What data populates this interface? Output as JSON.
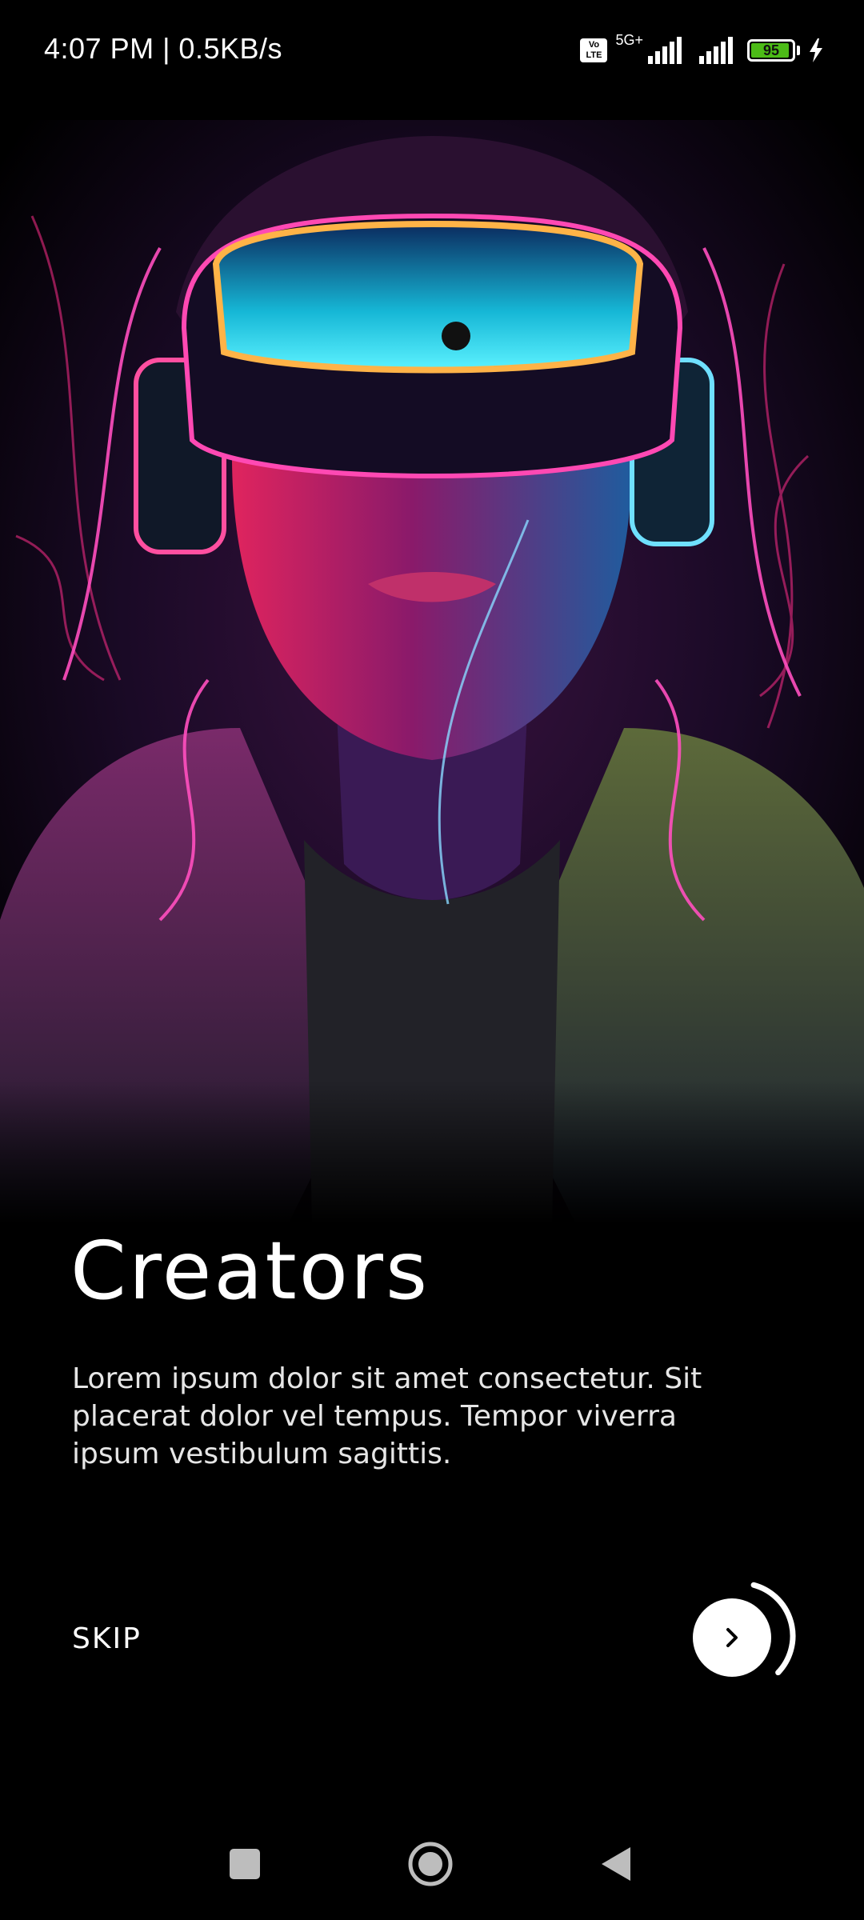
{
  "status_bar": {
    "time_speed": "4:07 PM | 0.5KB/s",
    "volte_label_top": "Vo",
    "volte_label_bottom": "LTE",
    "network_type": "5G+",
    "battery_level": "95",
    "battery_fraction": 0.95,
    "battery_color": "#4cbb17"
  },
  "onboarding": {
    "hero_image": "vr-headset-neon-portrait",
    "title": "Creators",
    "description": "Lorem ipsum dolor sit amet consectetur. Sit placerat dolor vel tempus. Tempor viverra ipsum vestibulum sagittis.",
    "skip_label": "SKIP",
    "next_icon": "chevron-right-icon",
    "progress_fraction": 0.33
  },
  "nav_bar": {
    "recents_icon": "square-icon",
    "home_icon": "circle-icon",
    "back_icon": "triangle-back-icon"
  }
}
